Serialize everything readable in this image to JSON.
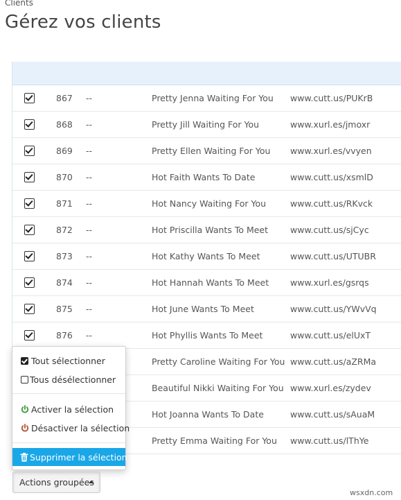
{
  "header": {
    "breadcrumb": "Clients",
    "title": "Gérez vos clients"
  },
  "rows": [
    {
      "id": "867",
      "dash": "--",
      "title": "Pretty Jenna Waiting For You",
      "url": "www.cutt.us/PUKrB",
      "checked": true
    },
    {
      "id": "868",
      "dash": "--",
      "title": "Pretty Jill Waiting For You",
      "url": "www.xurl.es/jmoxr",
      "checked": true
    },
    {
      "id": "869",
      "dash": "--",
      "title": "Pretty Ellen Waiting For You",
      "url": "www.xurl.es/vvyen",
      "checked": true
    },
    {
      "id": "870",
      "dash": "--",
      "title": "Hot Faith Wants To Date",
      "url": "www.cutt.us/xsmlD",
      "checked": true
    },
    {
      "id": "871",
      "dash": "--",
      "title": "Hot Nancy Waiting For You",
      "url": "www.cutt.us/RKvck",
      "checked": true
    },
    {
      "id": "872",
      "dash": "--",
      "title": "Hot Priscilla Wants To Meet",
      "url": "www.cutt.us/sjCyc",
      "checked": true
    },
    {
      "id": "873",
      "dash": "--",
      "title": "Hot Kathy Wants To Meet",
      "url": "www.cutt.us/UTUBR",
      "checked": true
    },
    {
      "id": "874",
      "dash": "--",
      "title": "Hot Hannah Wants To Meet",
      "url": "www.xurl.es/gsrqs",
      "checked": true
    },
    {
      "id": "875",
      "dash": "--",
      "title": "Hot June Wants To Meet",
      "url": "www.cutt.us/YWvVq",
      "checked": true
    },
    {
      "id": "876",
      "dash": "--",
      "title": "Hot Phyllis Wants To Meet",
      "url": "www.cutt.us/elUxT",
      "checked": true
    },
    {
      "id": "",
      "dash": "",
      "title": "Pretty Caroline Waiting For You",
      "url": "www.cutt.us/aZRMa",
      "checked": false
    },
    {
      "id": "",
      "dash": "",
      "title": "Beautiful Nikki Waiting For You",
      "url": "www.xurl.es/zydev",
      "checked": false
    },
    {
      "id": "",
      "dash": "",
      "title": "Hot Joanna Wants To Date",
      "url": "www.cutt.us/sAuaM",
      "checked": false
    },
    {
      "id": "",
      "dash": "",
      "title": "Pretty Emma Waiting For You",
      "url": "www.cutt.us/lThYe",
      "checked": false
    }
  ],
  "menu": {
    "select_all": "Tout sélectionner",
    "deselect_all": "Tous désélectionner",
    "activate": "Activer la sélection",
    "deactivate": "Désactiver la sélection",
    "delete": "Supprimer la sélection"
  },
  "actions_button": "Actions groupées",
  "watermark": "wsxdn.com",
  "colors": {
    "header_band": "#e6f1fb",
    "highlight": "#1aa7e8",
    "power_green": "#3c9a3c",
    "power_red": "#b5533a"
  },
  "icons": {
    "checked": "checkbox-checked-icon",
    "unchecked": "checkbox-empty-icon",
    "activate": "power-icon",
    "delete": "trash-icon",
    "caret": "caret-up-icon"
  }
}
